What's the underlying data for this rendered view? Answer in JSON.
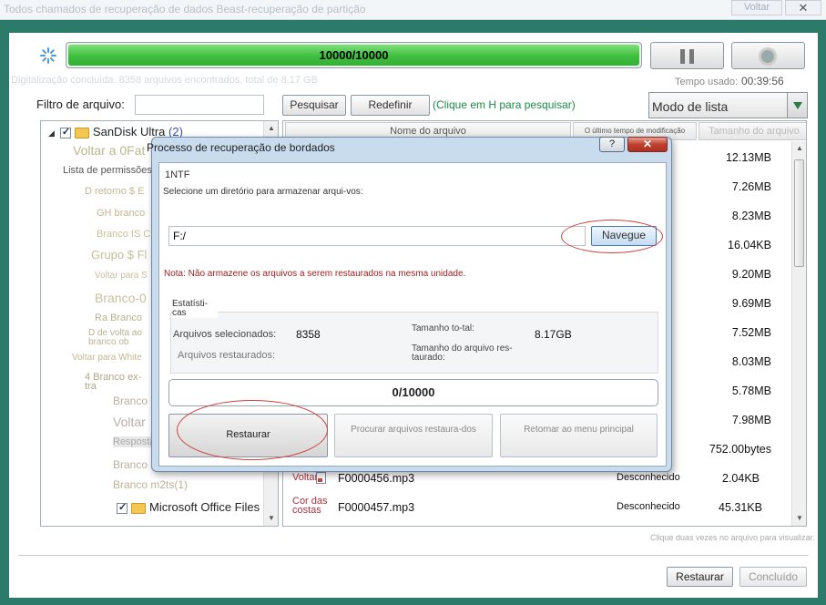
{
  "window": {
    "title": "Todos chamados de recuperação de dados Beast-recuperação de partição",
    "back_label": "Voltar",
    "close_label": "✕"
  },
  "scan": {
    "progress_text": "10000/10000",
    "progress_fraction": 1.0,
    "info": "Digitalização concluída. 8358 arquivos encontrados, total de 8.17 GB",
    "elapsed_label": "Tempo usado:",
    "elapsed_value": "00:39:56"
  },
  "filter": {
    "label": "Filtro de arquivo:",
    "input_value": "",
    "search_button": "Pesquisar",
    "reset_button": "Redefinir",
    "hint": "(Clique em H para pesquisar)",
    "view_mode": "Modo de lista"
  },
  "tree": {
    "root": {
      "label": "SanDisk Ultra",
      "count": "(2)"
    },
    "items": [
      "Voltar a 0Fat",
      "Lista de permissões 1NTF",
      "D retorno $ E",
      "GH branco",
      "Branco IS C",
      "Grupo $ Fl",
      "Voltar para S",
      "Branco-0",
      "Ra Branco",
      "D de volta ao branco ob",
      "Voltar para White",
      "4 Branco ex-tra",
      "Branco",
      "Voltar",
      "Resposta",
      "Branco",
      "Branco m2ts(1)"
    ],
    "last_item": "Microsoft Office Files"
  },
  "filelist": {
    "columns": [
      "Nome do arquivo",
      "O último tempo de modificação",
      "Tamanho do arquivo"
    ],
    "sizes": [
      "12.13MB",
      "7.26MB",
      "8.23MB",
      "16.04KB",
      "9.20MB",
      "9.69MB",
      "7.52MB",
      "8.03MB",
      "5.78MB",
      "7.98MB",
      "752.00bytes"
    ],
    "rows": [
      {
        "type": "Voltar",
        "name": "F0000456.mp3",
        "modified": "Desconhecido",
        "size": "2.04KB"
      },
      {
        "type": "Cor das costas",
        "name": "F0000457.mp3",
        "modified": "Desconhecido",
        "size": "45.31KB"
      }
    ],
    "hint": "Clique duas vezes no arquivo para visualizar."
  },
  "dialog": {
    "title": "Processo de recuperação de bordados",
    "help_label": "?",
    "close_label": "✕",
    "ntfs": "1NTF",
    "select_label": "Selecione um diretório para armazenar arqui-vos:",
    "path_value": "F:/",
    "browse_button": "Navegue",
    "note": "Nota: Não armazene os arquivos a serem restaurados na mesma unidade.",
    "stats_title": "Estatísti-cas",
    "selected_label": "Arquivos selecionados:",
    "selected_value": "8358",
    "total_size_label": "Tamanho to-tal:",
    "total_size_value": "8.17GB",
    "restored_label": "Arquivos restaurados:",
    "restored_size_label": "Tamanho do arquivo res-taurado:",
    "progress_text": "0/10000",
    "restore_button": "Restaurar",
    "find_button": "Procurar arquivos restaura-dos",
    "back_button": "Retornar ao menu principal"
  },
  "footer": {
    "restore_button": "Restaurar",
    "done_button": "Concluído"
  }
}
